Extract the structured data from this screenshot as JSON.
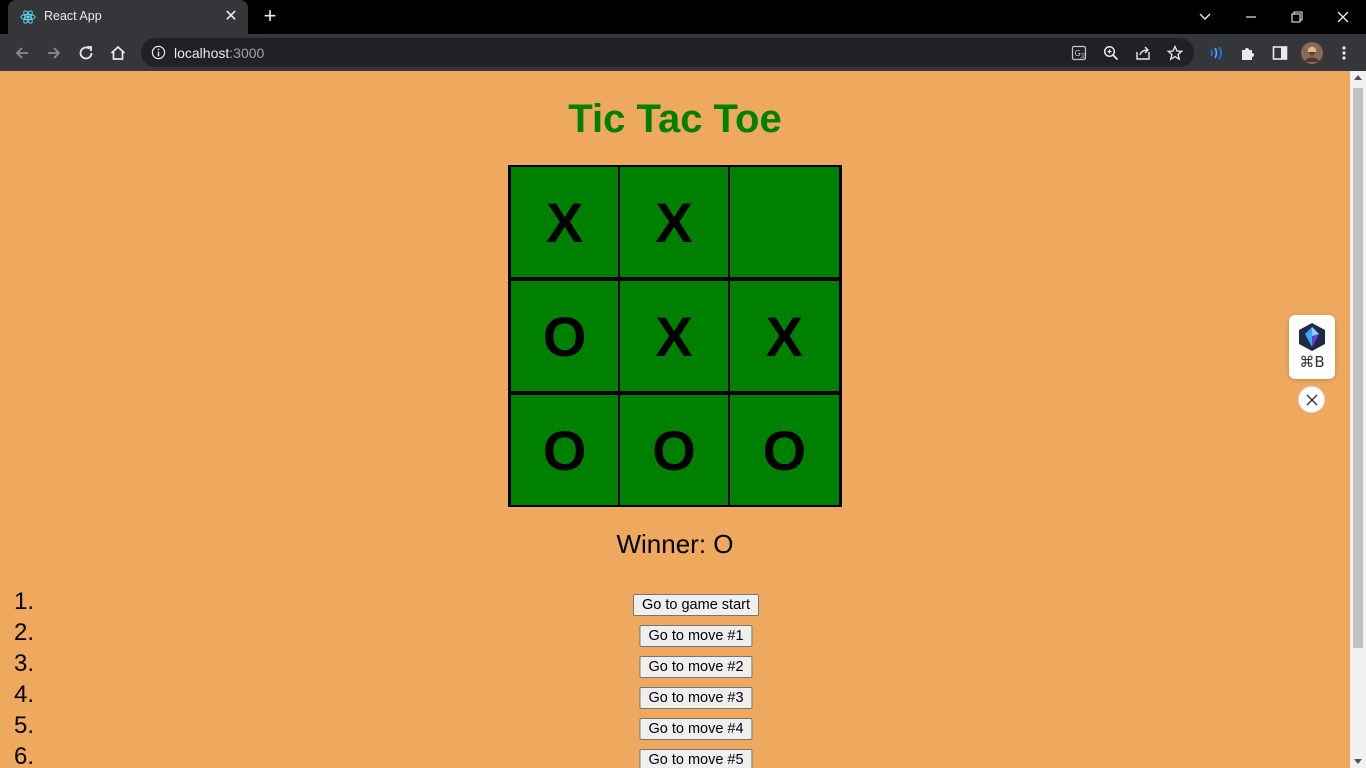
{
  "browser": {
    "tab_title": "React App",
    "url_host": "localhost",
    "url_port": ":3000"
  },
  "app": {
    "title": "Tic Tac Toe",
    "board": [
      [
        "X",
        "X",
        ""
      ],
      [
        "O",
        "X",
        "X"
      ],
      [
        "O",
        "O",
        "O"
      ]
    ],
    "status": "Winner: O",
    "moves": [
      {
        "number": "1.",
        "label": "Go to game start"
      },
      {
        "number": "2.",
        "label": "Go to move #1"
      },
      {
        "number": "3.",
        "label": "Go to move #2"
      },
      {
        "number": "4.",
        "label": "Go to move #3"
      },
      {
        "number": "5.",
        "label": "Go to move #4"
      },
      {
        "number": "6.",
        "label": "Go to move #5"
      }
    ]
  },
  "extension": {
    "shortcut": "⌘B"
  },
  "colors": {
    "page_background": "#eea95e",
    "title_color": "#008000",
    "cell_background": "#008000"
  }
}
